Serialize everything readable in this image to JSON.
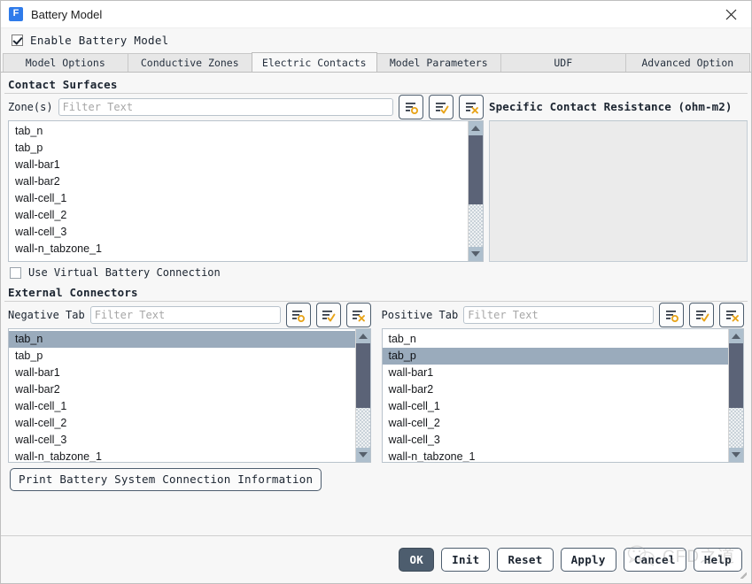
{
  "window": {
    "title": "Battery Model",
    "app_icon": "fluent-f-icon",
    "close_icon": "close-icon"
  },
  "enable": {
    "label": "Enable Battery Model",
    "checked": true
  },
  "tabs": [
    {
      "label": "Model Options",
      "active": false
    },
    {
      "label": "Conductive Zones",
      "active": false
    },
    {
      "label": "Electric Contacts",
      "active": true
    },
    {
      "label": "Model Parameters",
      "active": false
    },
    {
      "label": "UDF",
      "active": false
    },
    {
      "label": "Advanced Option",
      "active": false
    }
  ],
  "contact_surfaces": {
    "group_title": "Contact Surfaces",
    "zones_label": "Zone(s)",
    "filter_placeholder": "Filter Text",
    "filter_value": "",
    "tool_buttons": [
      {
        "name": "filter-list-icon",
        "marker": "circle"
      },
      {
        "name": "select-all-icon",
        "marker": "check"
      },
      {
        "name": "deselect-all-icon",
        "marker": "cross"
      }
    ],
    "zones": [
      "tab_n",
      "tab_p",
      "wall-bar1",
      "wall-bar2",
      "wall-cell_1",
      "wall-cell_2",
      "wall-cell_3",
      "wall-n_tabzone_1"
    ],
    "selected_zone": null,
    "resistance_header": "Specific Contact Resistance (ohm-m2)",
    "resistance_values": []
  },
  "virtual_connection": {
    "label": "Use Virtual Battery Connection",
    "checked": false
  },
  "external_connectors": {
    "group_title": "External Connectors",
    "negative": {
      "label": "Negative Tab",
      "filter_placeholder": "Filter Text",
      "filter_value": "",
      "items": [
        "tab_n",
        "tab_p",
        "wall-bar1",
        "wall-bar2",
        "wall-cell_1",
        "wall-cell_2",
        "wall-cell_3",
        "wall-n_tabzone_1"
      ],
      "selected": "tab_n"
    },
    "positive": {
      "label": "Positive Tab",
      "filter_placeholder": "Filter Text",
      "filter_value": "",
      "items": [
        "tab_n",
        "tab_p",
        "wall-bar1",
        "wall-bar2",
        "wall-cell_1",
        "wall-cell_2",
        "wall-cell_3",
        "wall-n_tabzone_1"
      ],
      "selected": "tab_p"
    }
  },
  "print_button": {
    "label": "Print Battery System Connection Information"
  },
  "footer_buttons": [
    {
      "label": "OK",
      "primary": true
    },
    {
      "label": "Init",
      "primary": false
    },
    {
      "label": "Reset",
      "primary": false
    },
    {
      "label": "Apply",
      "primary": false
    },
    {
      "label": "Cancel",
      "primary": false
    },
    {
      "label": "Help",
      "primary": false
    }
  ],
  "watermark": {
    "text": "CFD之道",
    "icon": "wechat-icon"
  },
  "colors": {
    "accent_orange": "#e8a317",
    "selection": "#9aabbc",
    "scroll_thumb": "#5b6377",
    "button_border": "#4d5d6e"
  }
}
